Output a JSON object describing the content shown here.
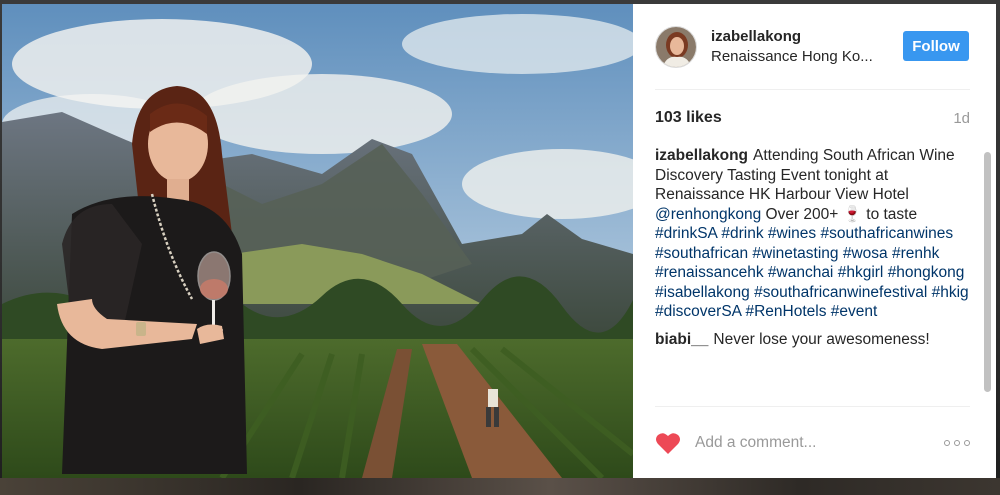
{
  "post": {
    "image_alt": "Woman holding a glass of wine in front of a mountain vineyard backdrop"
  },
  "header": {
    "username": "izabellakong",
    "location": "Renaissance Hong Ko...",
    "follow_label": "Follow"
  },
  "stats": {
    "likes": "103 likes",
    "time": "1d"
  },
  "caption": {
    "user": "izabellakong",
    "text_parts": [
      {
        "type": "text",
        "value": "Attending South African Wine Discovery Tasting Event tonight at Renaissance HK Harbour View Hotel "
      },
      {
        "type": "mention",
        "value": "@renhongkong"
      },
      {
        "type": "text",
        "value": " Over 200+ 🍷 to taste "
      },
      {
        "type": "tag",
        "value": "#drinkSA"
      },
      {
        "type": "text",
        "value": " "
      },
      {
        "type": "tag",
        "value": "#drink"
      },
      {
        "type": "text",
        "value": " "
      },
      {
        "type": "tag",
        "value": "#wines"
      },
      {
        "type": "text",
        "value": " "
      },
      {
        "type": "tag",
        "value": "#southafricanwines"
      },
      {
        "type": "text",
        "value": " "
      },
      {
        "type": "tag",
        "value": "#southafrican"
      },
      {
        "type": "text",
        "value": " "
      },
      {
        "type": "tag",
        "value": "#winetasting"
      },
      {
        "type": "text",
        "value": " "
      },
      {
        "type": "tag",
        "value": "#wosa"
      },
      {
        "type": "text",
        "value": " "
      },
      {
        "type": "tag",
        "value": "#renhk"
      },
      {
        "type": "text",
        "value": " "
      },
      {
        "type": "tag",
        "value": "#renaissancehk"
      },
      {
        "type": "text",
        "value": " "
      },
      {
        "type": "tag",
        "value": "#wanchai"
      },
      {
        "type": "text",
        "value": " "
      },
      {
        "type": "tag",
        "value": "#hkgirl"
      },
      {
        "type": "text",
        "value": " "
      },
      {
        "type": "tag",
        "value": "#hongkong"
      },
      {
        "type": "text",
        "value": " "
      },
      {
        "type": "tag",
        "value": "#isabellakong"
      },
      {
        "type": "text",
        "value": " "
      },
      {
        "type": "tag",
        "value": "#southafricanwinefestival"
      },
      {
        "type": "text",
        "value": " "
      },
      {
        "type": "tag",
        "value": "#hkig"
      },
      {
        "type": "text",
        "value": " "
      },
      {
        "type": "tag",
        "value": "#discoverSA"
      },
      {
        "type": "text",
        "value": " "
      },
      {
        "type": "tag",
        "value": "#RenHotels"
      },
      {
        "type": "text",
        "value": " "
      },
      {
        "type": "tag",
        "value": "#event"
      }
    ]
  },
  "comments": [
    {
      "user": "biabi__",
      "text": "Never lose your awesomeness!"
    }
  ],
  "comment_bar": {
    "placeholder": "Add a comment...",
    "like_icon": "heart-icon",
    "more_icon": "more-options-icon"
  },
  "colors": {
    "follow_button": "#3897f0",
    "hashtag": "#003569",
    "heart": "#ed4956",
    "muted_text": "#999999"
  }
}
